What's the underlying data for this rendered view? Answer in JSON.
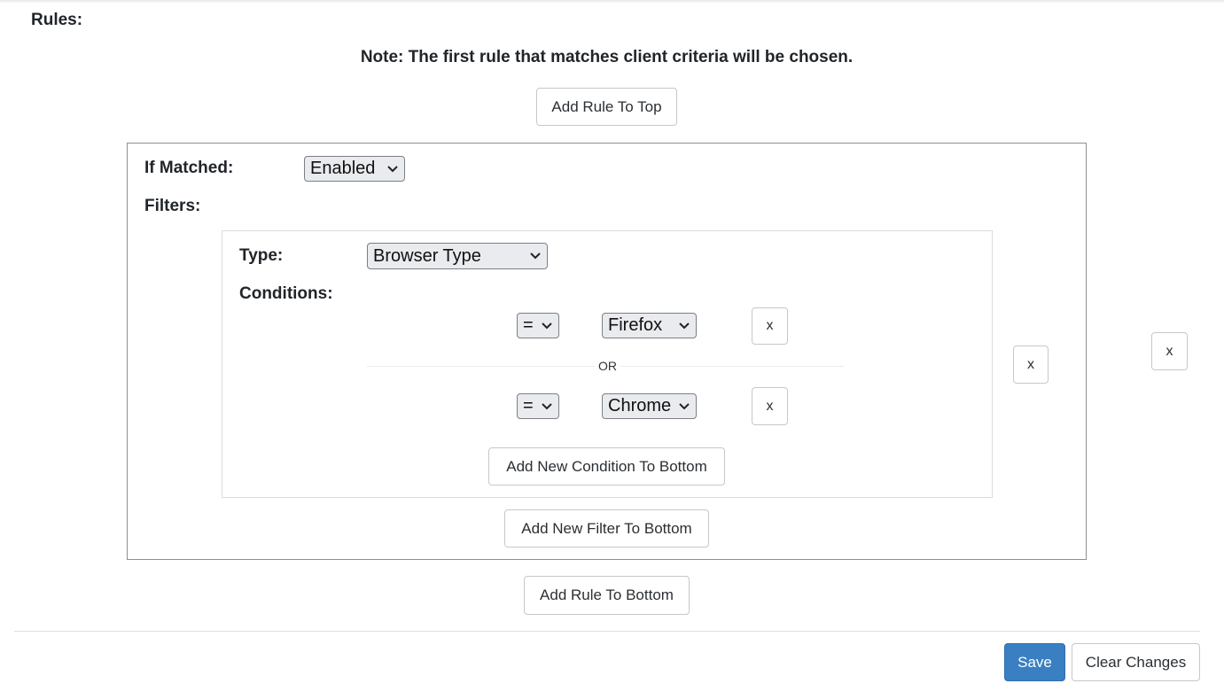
{
  "rules_label": "Rules:",
  "note": "Note: The first rule that matches client criteria will be chosen.",
  "add_rule_top_label": "Add Rule To Top",
  "add_rule_bottom_label": "Add Rule To Bottom",
  "rule": {
    "if_matched_label": "If Matched:",
    "if_matched_value": "Enabled",
    "filters_label": "Filters:",
    "remove_label": "x",
    "filter": {
      "type_label": "Type:",
      "type_value": "Browser Type",
      "conditions_label": "Conditions:",
      "remove_label": "x",
      "conditions": [
        {
          "operator": "=",
          "value": "Firefox",
          "remove_label": "x"
        },
        {
          "operator": "=",
          "value": "Chrome",
          "remove_label": "x"
        }
      ],
      "or_label": "OR",
      "add_condition_label": "Add New Condition To Bottom"
    },
    "add_filter_label": "Add New Filter To Bottom"
  },
  "outer_remove_label": "x",
  "footer": {
    "save_label": "Save",
    "clear_label": "Clear Changes"
  },
  "colors": {
    "primary": "#3a7fc1",
    "border": "#8f8f8f",
    "text": "#212529"
  }
}
